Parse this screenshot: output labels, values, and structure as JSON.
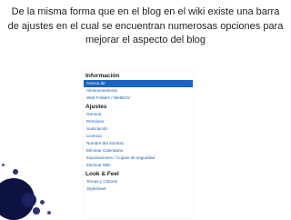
{
  "slide": {
    "title": "De la misma forma que en el blog en el wiki existe una barra de ajustes en el cual se encuentran numerosas opciones para mejorar el aspecto del blog"
  },
  "sidebar": {
    "sections": [
      {
        "header": "Información",
        "items": [
          {
            "label": "Acerca de",
            "selected": true
          },
          {
            "label": "Almacenamiento"
          },
          {
            "label": "Web Folders / WebDAV"
          }
        ]
      },
      {
        "header": "Ajustes",
        "items": [
          {
            "label": "General"
          },
          {
            "label": "Permisos"
          },
          {
            "label": "Suscripción"
          },
          {
            "label": "Licencia"
          },
          {
            "label": "Nombre del dominio"
          },
          {
            "label": "Eliminar Calendario"
          },
          {
            "label": "Exportaciones / Copias de seguridad"
          },
          {
            "label": "Eliminar Wiki"
          }
        ]
      },
      {
        "header": "Look & Feel",
        "items": [
          {
            "label": "Temas y Colores"
          },
          {
            "label": "Stylesheet"
          }
        ]
      }
    ]
  },
  "colors": {
    "selected_bg": "#1a63c2",
    "link": "#1a5fa8",
    "decoration": "#0d1240"
  }
}
